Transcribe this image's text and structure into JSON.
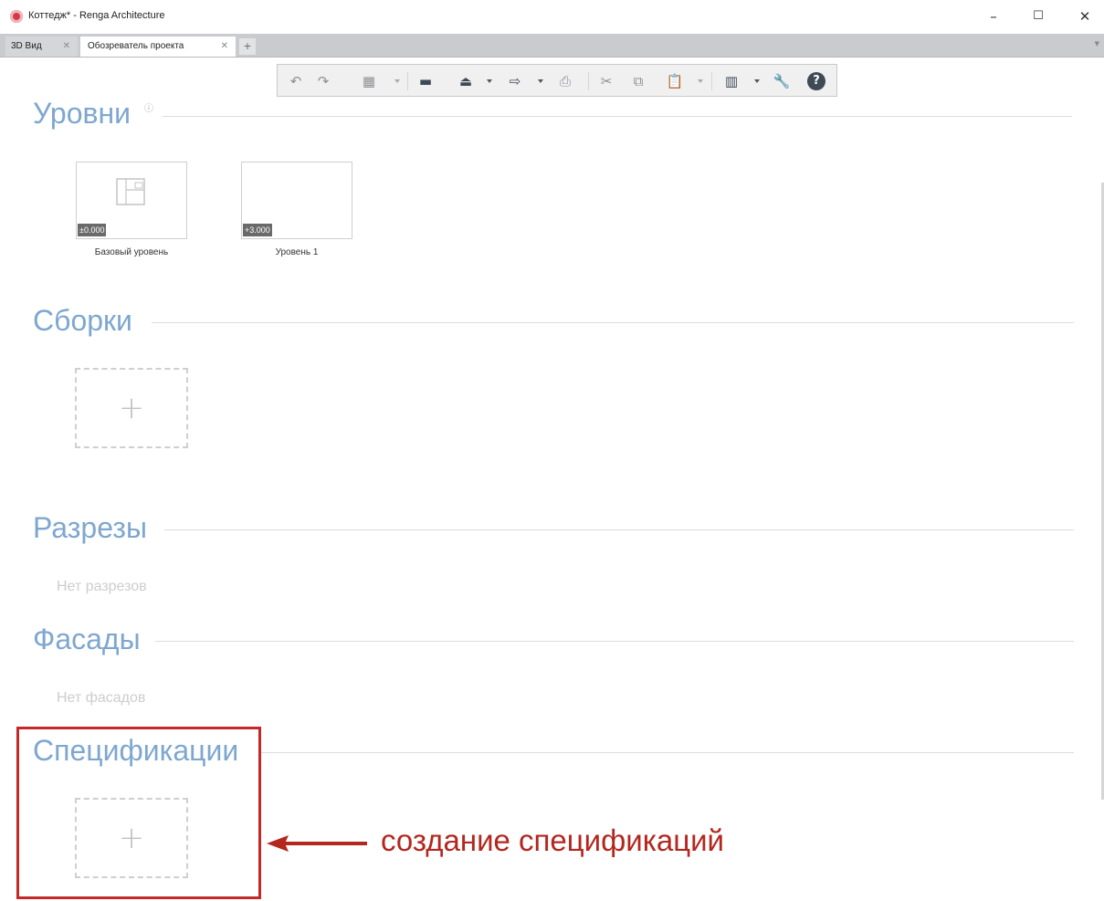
{
  "window": {
    "title": "Коттедж* - Renga Architecture",
    "controls": {
      "minimize": "–",
      "maximize": "☐",
      "close": "✕"
    }
  },
  "tabs": [
    {
      "label": "3D Вид",
      "active": false
    },
    {
      "label": "Обозреватель проекта",
      "active": true
    }
  ],
  "tab_add_label": "+",
  "toolbar": {
    "icons": [
      "undo-icon",
      "redo-icon",
      "model-icon",
      "folder-icon",
      "stamp-icon",
      "export-icon",
      "print-icon",
      "cut-icon",
      "copy-icon",
      "paste-icon",
      "layout-icon",
      "wrench-icon",
      "help-icon"
    ]
  },
  "sections": {
    "levels": {
      "title": "Уровни",
      "items": [
        {
          "label": "Базовый уровень",
          "elevation": "±0.000"
        },
        {
          "label": "Уровень 1",
          "elevation": "+3.000"
        }
      ]
    },
    "assemblies": {
      "title": "Сборки",
      "add_label": "+"
    },
    "sections": {
      "title": "Разрезы",
      "empty": "Нет разрезов"
    },
    "facades": {
      "title": "Фасады",
      "empty": "Нет фасадов"
    },
    "specifications": {
      "title": "Спецификации",
      "add_label": "+"
    }
  },
  "annotation": {
    "text": "создание спецификаций",
    "color": "#b3271f"
  },
  "colors": {
    "section_title": "#7ea7d0",
    "highlight": "#c62828"
  }
}
